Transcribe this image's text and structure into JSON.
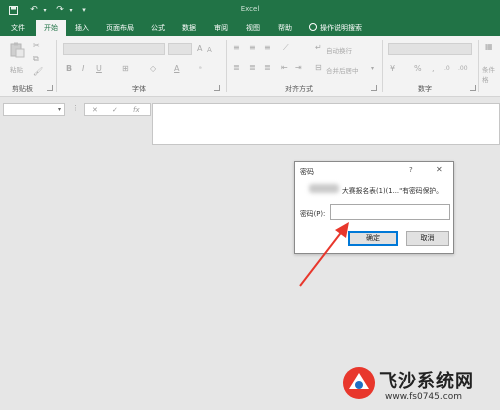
{
  "titlebar": {
    "app_name": "Excel",
    "icons": [
      "save-icon",
      "undo-icon",
      "redo-icon",
      "customize-qat-icon"
    ]
  },
  "tabs": [
    "文件",
    "开始",
    "插入",
    "页面布局",
    "公式",
    "数据",
    "审阅",
    "视图",
    "帮助",
    "操作说明搜索"
  ],
  "active_tab": "开始",
  "ribbon": {
    "groups": {
      "clipboard": "剪贴板",
      "font": "字体",
      "alignment": "对齐方式",
      "number": "数字"
    },
    "paste_label": "粘贴",
    "wrap_text": "自动换行",
    "merge_center": "合并后居中",
    "cells_partial": "条件格"
  },
  "formula_bar": {
    "cancel": "✕",
    "enter": "✓",
    "fx": "fx"
  },
  "dialog": {
    "title": "密码",
    "help": "?",
    "close": "✕",
    "message": "大赛报名表(1)(1...\"有密码保护。",
    "password_label": "密码(P):",
    "password_value": "",
    "ok_label": "确定",
    "cancel_label": "取消"
  },
  "watermark": {
    "name": "飞沙系统网",
    "url": "www.fs0745.com"
  },
  "colors": {
    "excel_green": "#217346",
    "arrow_red": "#e8372c",
    "focus_blue": "#0078d7"
  }
}
